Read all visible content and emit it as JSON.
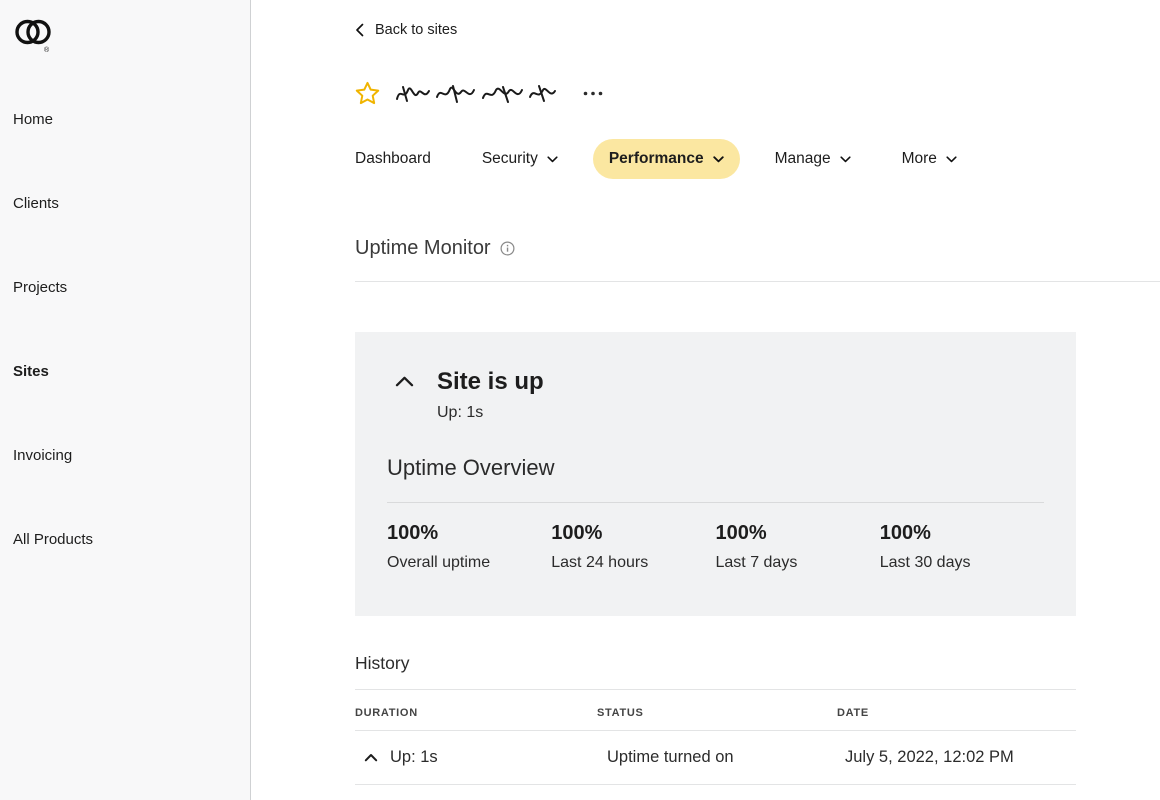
{
  "colors": {
    "tab_active_bg": "#fbe7a1",
    "star_yellow": "#f0b400",
    "card_bg": "#f1f2f3",
    "sidebar_bg": "#f8f8f9"
  },
  "icons": {
    "logo": "godaddy-logo",
    "back": "chevron-left",
    "favorite": "star-outline",
    "options": "ellipsis",
    "info": "info-circle",
    "collapse": "chevron-up",
    "dropdown": "chevron-down",
    "row_expand": "chevron-up"
  },
  "sidebar": {
    "items": [
      {
        "label": "Home",
        "active": false
      },
      {
        "label": "Clients",
        "active": false
      },
      {
        "label": "Projects",
        "active": false
      },
      {
        "label": "Sites",
        "active": true
      },
      {
        "label": "Invoicing",
        "active": false
      },
      {
        "label": "All Products",
        "active": false
      }
    ]
  },
  "page_header": {
    "back_label": "Back to sites",
    "site_name_redacted": true
  },
  "tabs": {
    "items": [
      {
        "label": "Dashboard",
        "dropdown": false,
        "active": false
      },
      {
        "label": "Security",
        "dropdown": true,
        "active": false
      },
      {
        "label": "Performance",
        "dropdown": true,
        "active": true
      },
      {
        "label": "Manage",
        "dropdown": true,
        "active": false
      },
      {
        "label": "More",
        "dropdown": true,
        "active": false
      }
    ]
  },
  "uptime": {
    "section_title": "Uptime Monitor",
    "status_title": "Site is up",
    "status_duration": "Up: 1s",
    "overview_title": "Uptime Overview",
    "stats": [
      {
        "value": "100%",
        "label": "Overall uptime"
      },
      {
        "value": "100%",
        "label": "Last 24 hours"
      },
      {
        "value": "100%",
        "label": "Last 7 days"
      },
      {
        "value": "100%",
        "label": "Last 30 days"
      }
    ]
  },
  "history": {
    "title": "History",
    "columns": {
      "duration": "Duration",
      "status": "Status",
      "date": "Date"
    },
    "rows": [
      {
        "duration": "Up: 1s",
        "status": "Uptime turned on",
        "date": "July 5, 2022, 12:02 PM"
      }
    ]
  }
}
